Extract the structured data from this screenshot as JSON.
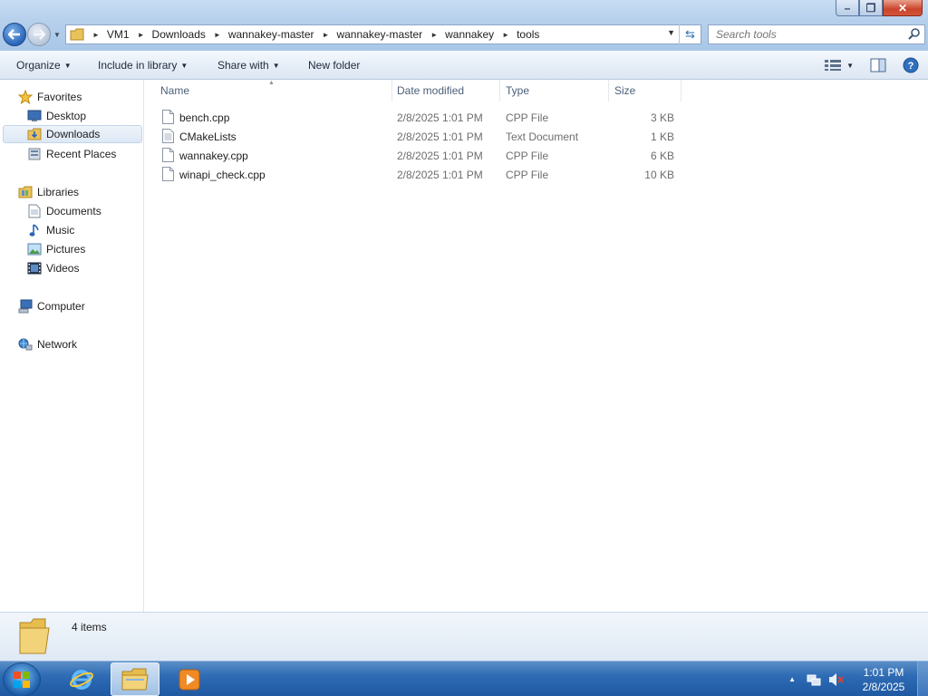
{
  "window": {
    "controls": {
      "minimize": "–",
      "maximize": "❐",
      "close": "✕"
    }
  },
  "address": {
    "crumbs": [
      "VM1",
      "Downloads",
      "wannakey-master",
      "wannakey-master",
      "wannakey",
      "tools"
    ]
  },
  "search": {
    "placeholder": "Search tools"
  },
  "toolbar": {
    "organize": "Organize",
    "include_in_library": "Include in library",
    "share_with": "Share with",
    "new_folder": "New folder"
  },
  "nav": {
    "favorites": "Favorites",
    "desktop": "Desktop",
    "downloads": "Downloads",
    "recent_places": "Recent Places",
    "libraries": "Libraries",
    "documents": "Documents",
    "music": "Music",
    "pictures": "Pictures",
    "videos": "Videos",
    "computer": "Computer",
    "network": "Network"
  },
  "columns": {
    "name": "Name",
    "date": "Date modified",
    "type": "Type",
    "size": "Size"
  },
  "files": [
    {
      "name": "bench.cpp",
      "date": "2/8/2025 1:01 PM",
      "type": "CPP File",
      "size": "3 KB"
    },
    {
      "name": "CMakeLists",
      "date": "2/8/2025 1:01 PM",
      "type": "Text Document",
      "size": "1 KB"
    },
    {
      "name": "wannakey.cpp",
      "date": "2/8/2025 1:01 PM",
      "type": "CPP File",
      "size": "6 KB"
    },
    {
      "name": "winapi_check.cpp",
      "date": "2/8/2025 1:01 PM",
      "type": "CPP File",
      "size": "10 KB"
    }
  ],
  "details": {
    "count": "4 items"
  },
  "taskbar": {
    "time": "1:01 PM",
    "date": "2/8/2025"
  },
  "colors": {
    "accent": "#2a64b8",
    "taskbar": "#2f6cb5",
    "selection": "#dde8f5"
  }
}
